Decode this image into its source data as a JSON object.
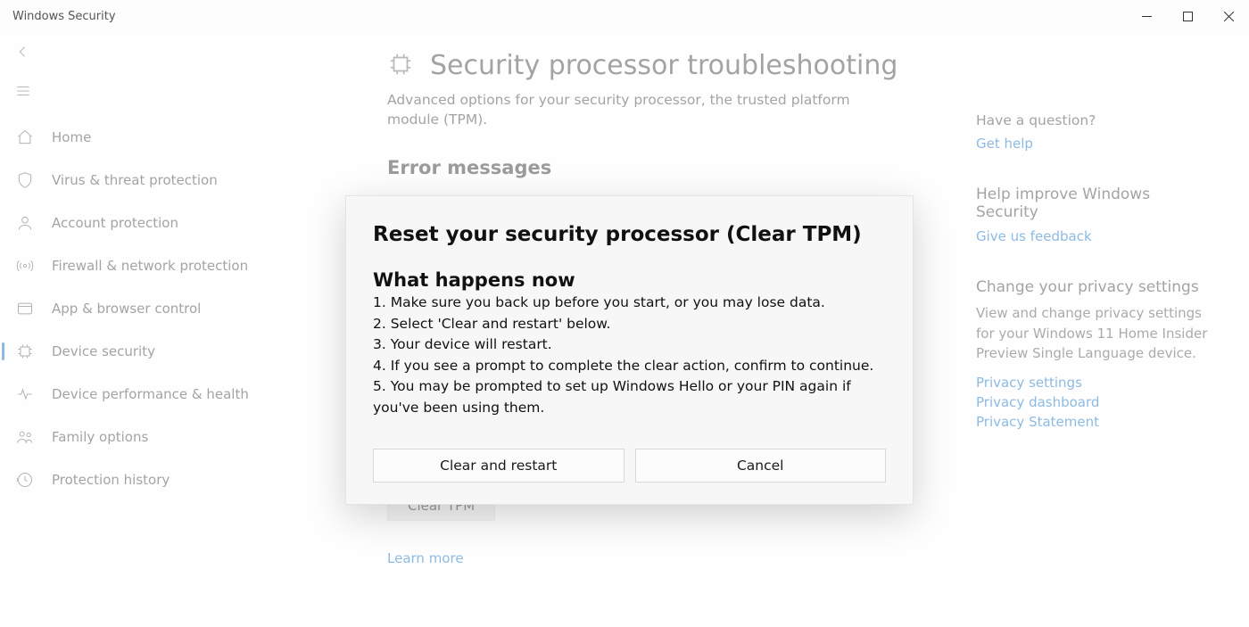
{
  "window": {
    "title": "Windows Security"
  },
  "sidebar": {
    "items": [
      {
        "label": "Home"
      },
      {
        "label": "Virus & threat protection"
      },
      {
        "label": "Account protection"
      },
      {
        "label": "Firewall & network protection"
      },
      {
        "label": "App & browser control"
      },
      {
        "label": "Device security"
      },
      {
        "label": "Device performance & health"
      },
      {
        "label": "Family options"
      },
      {
        "label": "Protection history"
      }
    ]
  },
  "main": {
    "title": "Security processor troubleshooting",
    "subtitle": "Advanced options for your security processor, the trusted platform module (TPM).",
    "error_heading": "Error messages",
    "clear_tpm_btn": "Clear TPM",
    "learn_more": "Learn more"
  },
  "right": {
    "q_heading": "Have a question?",
    "get_help": "Get help",
    "improve_heading": "Help improve Windows Security",
    "feedback": "Give us feedback",
    "privacy_heading": "Change your privacy settings",
    "privacy_desc": "View and change privacy settings for your Windows 11 Home Insider Preview Single Language device.",
    "links": {
      "settings": "Privacy settings",
      "dashboard": "Privacy dashboard",
      "statement": "Privacy Statement"
    }
  },
  "dialog": {
    "title": "Reset your security processor (Clear TPM)",
    "subheading": "What happens now",
    "steps": [
      "1. Make sure you back up before you start, or you may lose data.",
      "2. Select 'Clear and restart' below.",
      "3. Your device will restart.",
      "4. If you see a prompt to complete the clear action, confirm to continue.",
      "5. You may be prompted to set up Windows Hello or your PIN again if you've been using them."
    ],
    "btn_clear": "Clear and restart",
    "btn_cancel": "Cancel"
  }
}
